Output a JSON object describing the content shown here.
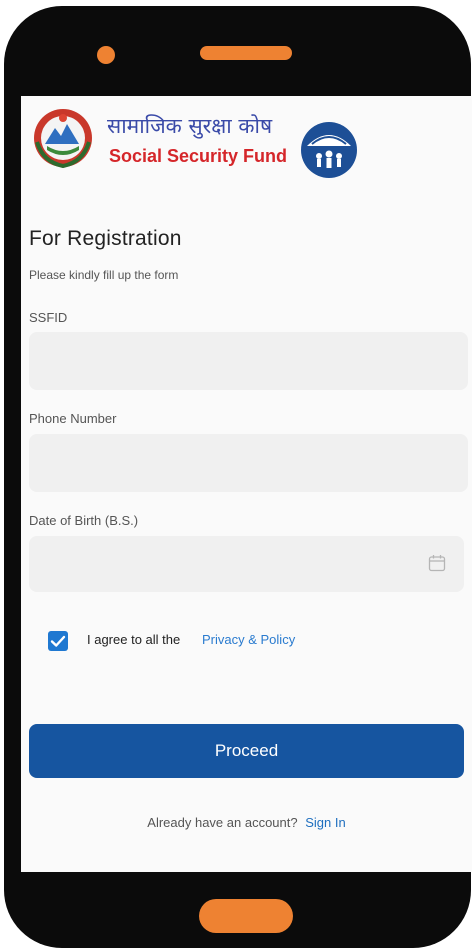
{
  "header": {
    "brand_nepali": "सामाजिक सुरक्षा कोष",
    "brand_english": "Social Security Fund"
  },
  "form": {
    "title": "For Registration",
    "subtitle": "Please kindly fill up the form",
    "fields": [
      {
        "label": "SSFID",
        "value": "",
        "placeholder": ""
      },
      {
        "label": "Phone Number",
        "value": "",
        "placeholder": ""
      },
      {
        "label": "Date of Birth (B.S.)",
        "value": "",
        "placeholder": "",
        "icon": "calendar-icon"
      }
    ],
    "agree_text": "I agree to all the",
    "policy_link": "Privacy & Policy",
    "agree_checked": true,
    "submit_label": "Proceed"
  },
  "footer": {
    "question": "Already have an account?",
    "signin_label": "Sign In"
  },
  "colors": {
    "primary": "#1655a0",
    "link": "#2a7bcf",
    "accent_orange": "#ee8232",
    "brand_red": "#d5262a",
    "brand_blue": "#3a4aa8"
  }
}
